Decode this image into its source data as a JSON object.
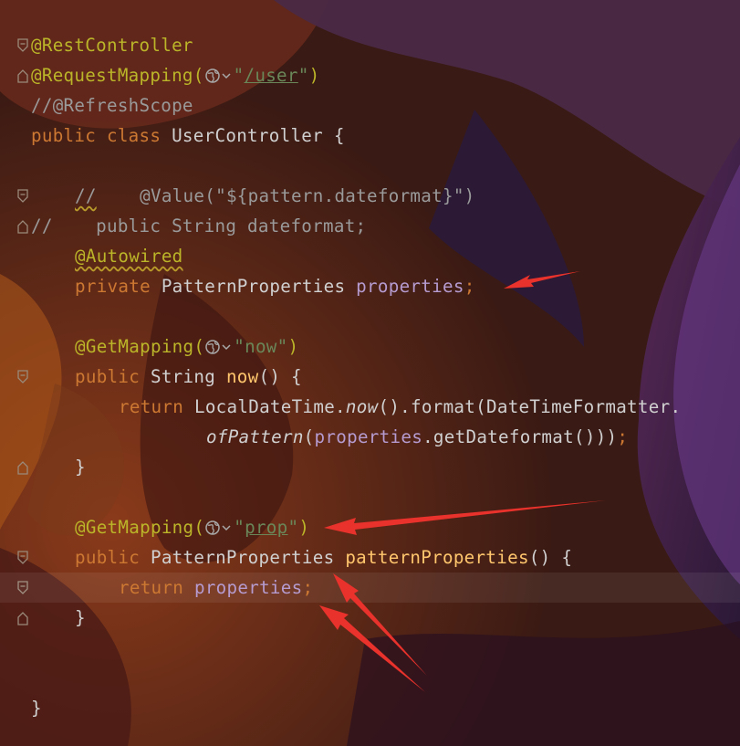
{
  "editor": {
    "lines": {
      "l1_ann": "@RestController",
      "l2_ann": "@RequestMapping(",
      "l2_q1": "\"",
      "l2_url": "/user",
      "l2_q2": "\"",
      "l2_close": ")",
      "l3_comment": "//@RefreshScope",
      "l4_kw": "public class ",
      "l4_name": "UserController {",
      "l6_comment_mark": "//",
      "l6_comment_rest": "    @Value(\"${pattern.dateformat}\")",
      "l7_comment": "//    public String dateformat;",
      "l8_ann": "@Autowired",
      "l9_kw": "private ",
      "l9_type": "PatternProperties ",
      "l9_field": "properties",
      "l9_semi": ";",
      "l11_ann": "@GetMapping(",
      "l11_str": "\"now\"",
      "l11_close": ")",
      "l12_kw": "public ",
      "l12_type": "String ",
      "l12_name": "now",
      "l12_rest": "() {",
      "l13_kw": "return ",
      "l13_cls": "LocalDateTime.",
      "l13_now": "now",
      "l13_rest": "().format(DateTimeFormatter.",
      "l14_of": "ofPattern",
      "l14_p1": "(",
      "l14_field": "properties",
      "l14_rest": ".getDateformat()))",
      "l14_semi": ";",
      "l15_close": "}",
      "l17_ann": "@GetMapping(",
      "l17_q1": "\"",
      "l17_url": "prop",
      "l17_q2": "\"",
      "l17_close": ")",
      "l18_kw": "public ",
      "l18_type": "PatternProperties ",
      "l18_name": "patternProperties",
      "l18_rest": "() {",
      "l19_kw": "return ",
      "l19_field": "properties",
      "l19_semi": ";",
      "l20_close": "}",
      "l23_close": "}"
    }
  },
  "icons": {
    "globe": "globe-icon",
    "chevron": "chevron-down-icon",
    "fold": "fold-marker-icon",
    "arrow": "annotation-arrow"
  },
  "colors": {
    "keyword": "#cc7832",
    "annotation": "#bbb529",
    "string": "#6a8759",
    "field": "#b59bcf",
    "method": "#ffc66d",
    "comment": "#9a9a9a",
    "plain": "#d0d0d0",
    "arrow": "#e8322b"
  }
}
